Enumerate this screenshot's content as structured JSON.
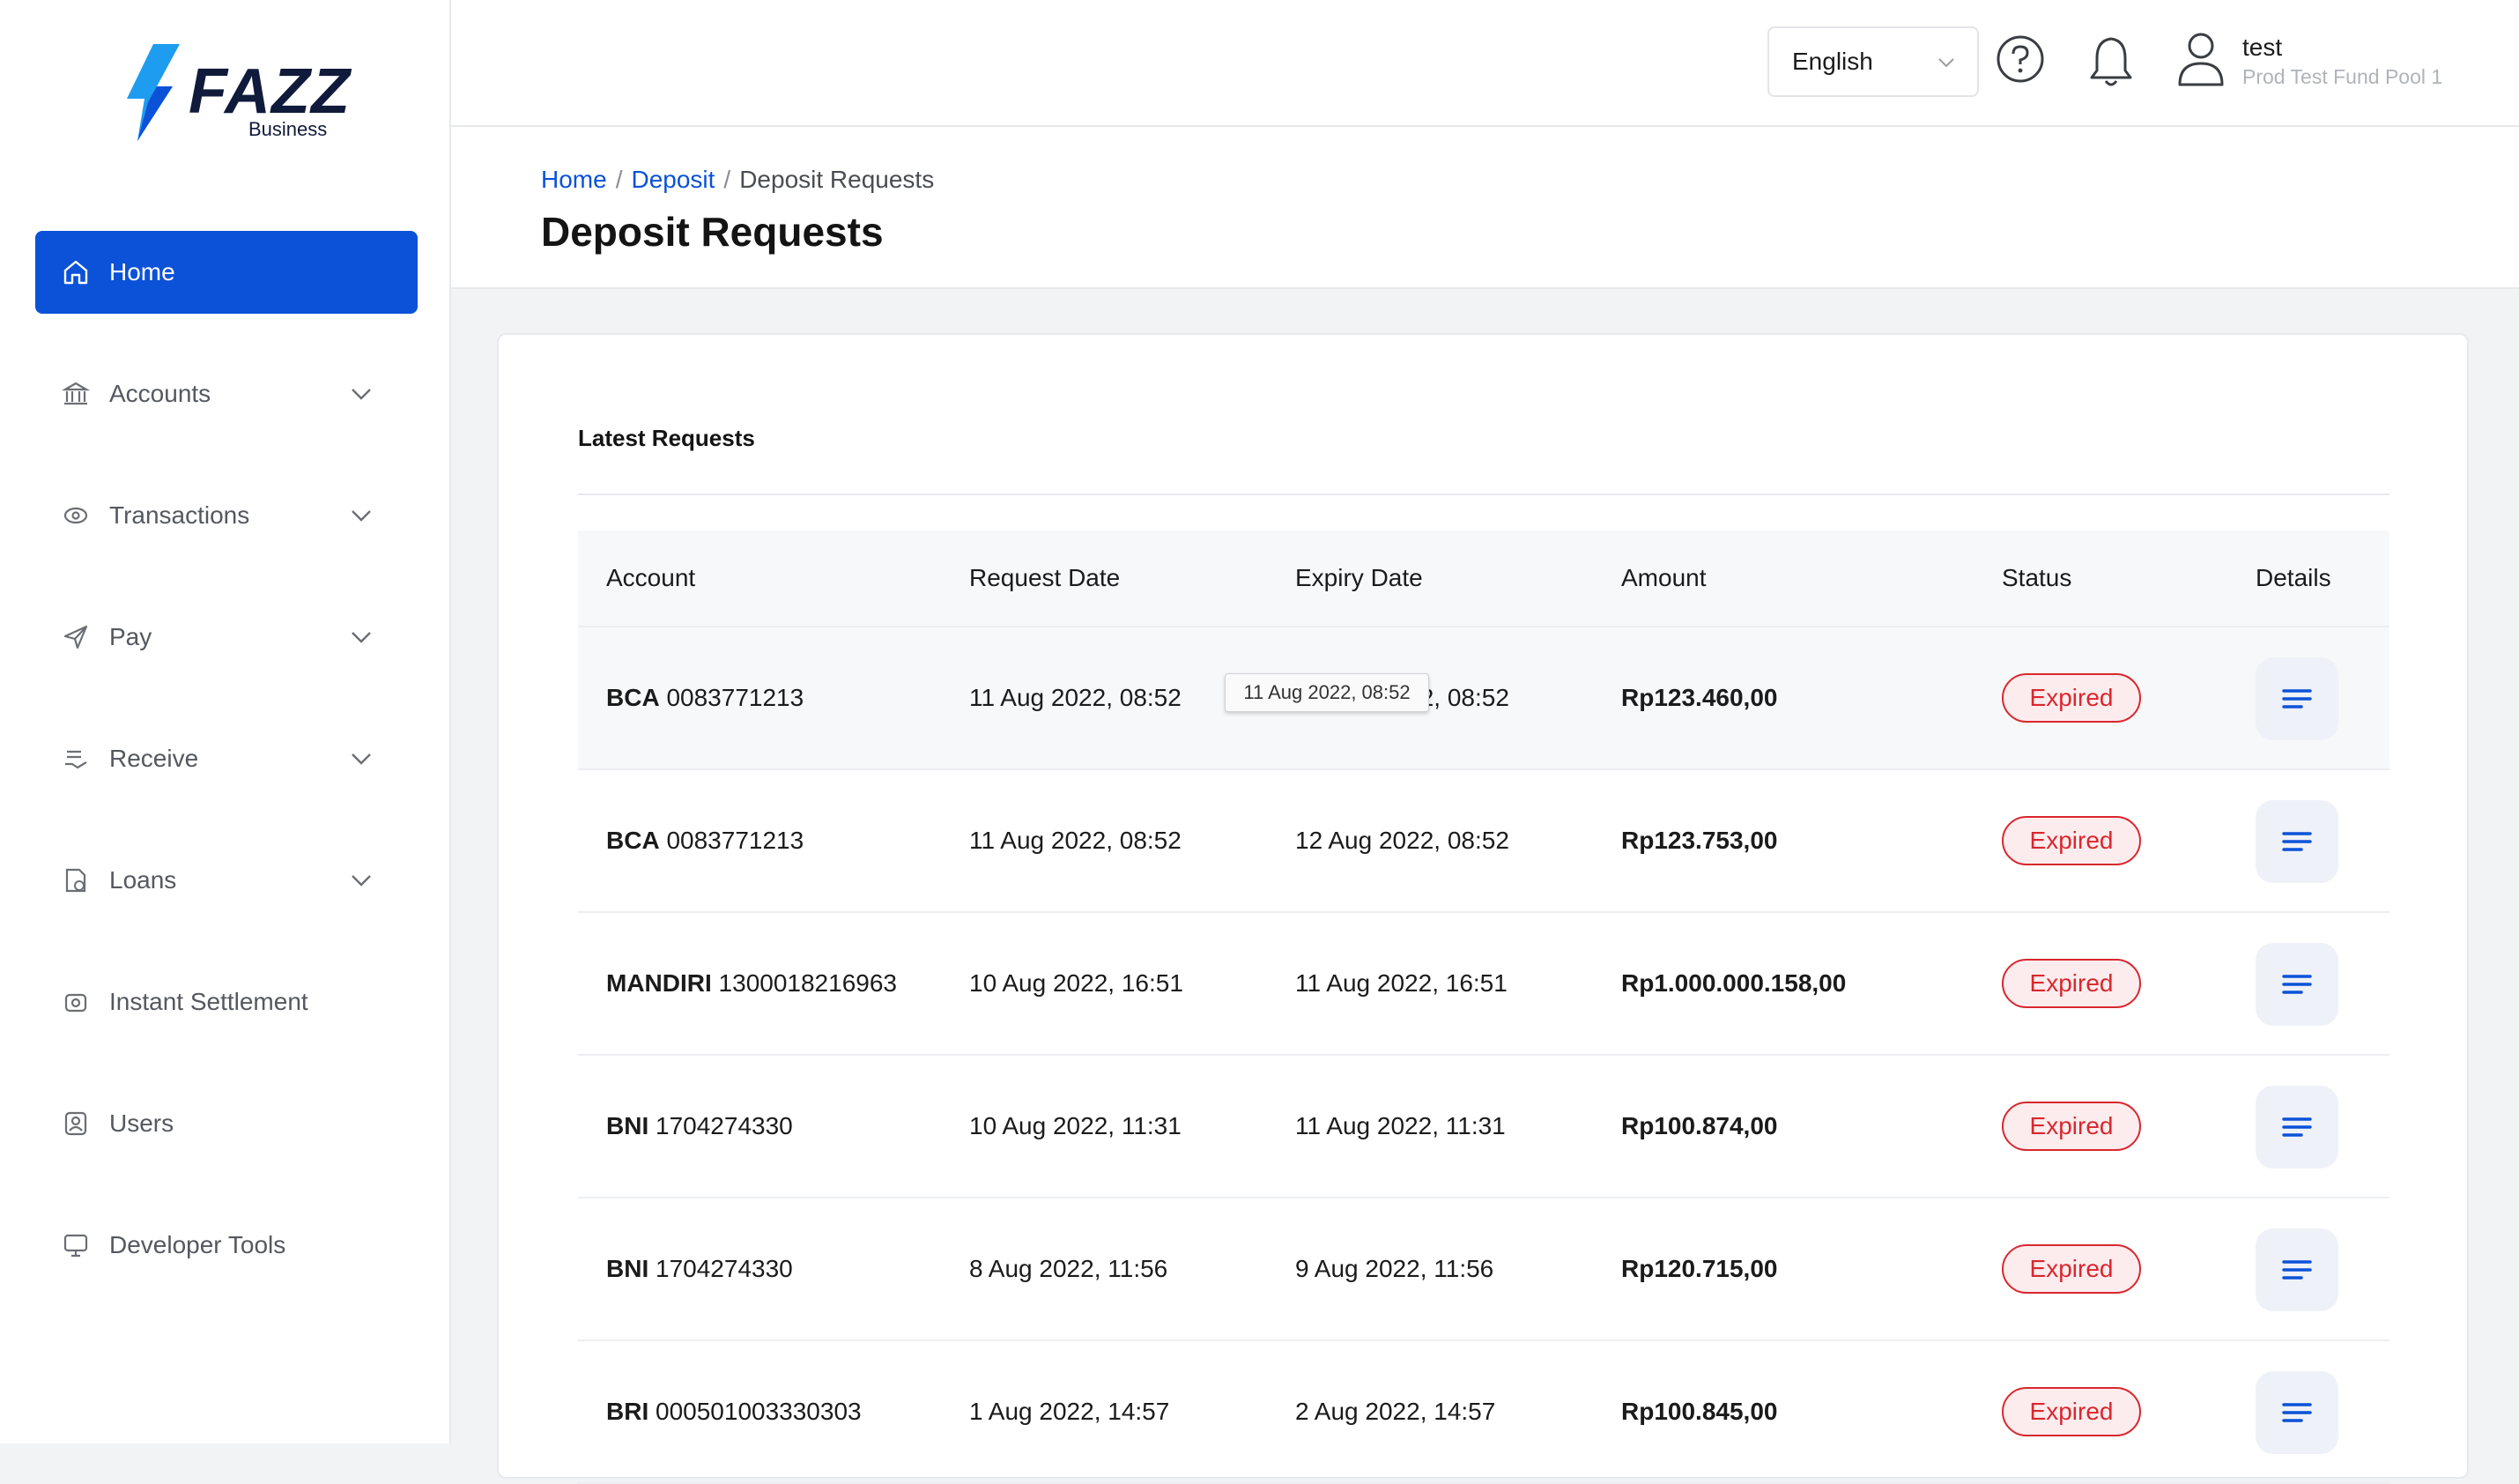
{
  "brand": {
    "name": "FAZZ",
    "sub": "Business",
    "accent": "#0b52d8"
  },
  "sidebar": {
    "items": [
      {
        "label": "Home",
        "icon": "home-icon",
        "active": true
      },
      {
        "label": "Accounts",
        "icon": "bank-icon",
        "expandable": true
      },
      {
        "label": "Transactions",
        "icon": "transactions-icon",
        "expandable": true
      },
      {
        "label": "Pay",
        "icon": "send-icon",
        "expandable": true
      },
      {
        "label": "Receive",
        "icon": "receive-icon",
        "expandable": true
      },
      {
        "label": "Loans",
        "icon": "loans-icon",
        "expandable": true
      },
      {
        "label": "Instant Settlement",
        "icon": "settlement-icon"
      },
      {
        "label": "Users",
        "icon": "users-icon"
      },
      {
        "label": "Developer Tools",
        "icon": "monitor-icon"
      }
    ]
  },
  "topbar": {
    "language": "English",
    "user": {
      "name": "test",
      "org": "Prod Test Fund Pool 1"
    }
  },
  "breadcrumb": {
    "home": "Home",
    "deposit": "Deposit",
    "current": "Deposit Requests",
    "separator": "/"
  },
  "page_title": "Deposit Requests",
  "card": {
    "title": "Latest Requests"
  },
  "table": {
    "headers": {
      "account": "Account",
      "request_date": "Request Date",
      "expiry_date": "Expiry Date",
      "amount": "Amount",
      "status": "Status",
      "details": "Details"
    },
    "rows": [
      {
        "bank": "BCA",
        "number": "0083771213",
        "request_date": "11 Aug 2022, 08:52",
        "expiry_date": "12 Aug 2022, 08:52",
        "amount": "Rp123.460,00",
        "status": "Expired"
      },
      {
        "bank": "BCA",
        "number": "0083771213",
        "request_date": "11 Aug 2022, 08:52",
        "expiry_date": "12 Aug 2022, 08:52",
        "amount": "Rp123.753,00",
        "status": "Expired"
      },
      {
        "bank": "MANDIRI",
        "number": "1300018216963",
        "request_date": "10 Aug 2022, 16:51",
        "expiry_date": "11 Aug 2022, 16:51",
        "amount": "Rp1.000.000.158,00",
        "status": "Expired"
      },
      {
        "bank": "BNI",
        "number": "1704274330",
        "request_date": "10 Aug 2022, 11:31",
        "expiry_date": "11 Aug 2022, 11:31",
        "amount": "Rp100.874,00",
        "status": "Expired"
      },
      {
        "bank": "BNI",
        "number": "1704274330",
        "request_date": "8 Aug 2022, 11:56",
        "expiry_date": "9 Aug 2022, 11:56",
        "amount": "Rp120.715,00",
        "status": "Expired"
      },
      {
        "bank": "BRI",
        "number": "000501003330303",
        "request_date": "1 Aug 2022, 14:57",
        "expiry_date": "2 Aug 2022, 14:57",
        "amount": "Rp100.845,00",
        "status": "Expired"
      }
    ]
  },
  "tooltip": {
    "text": "11 Aug 2022, 08:52"
  }
}
